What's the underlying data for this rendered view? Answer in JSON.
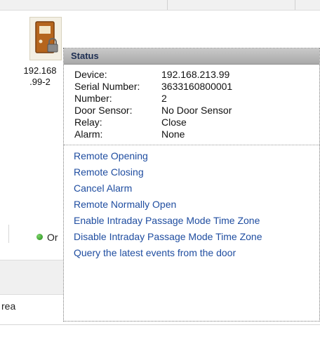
{
  "device": {
    "label_line1": "192.168",
    "label_line2": ".99-2",
    "status_text": "Or"
  },
  "table": {
    "cell_text": "rea"
  },
  "popup": {
    "title": "Status",
    "info": [
      {
        "label": "Device:",
        "value": "192.168.213.99"
      },
      {
        "label": "Serial Number:",
        "value": "3633160800001"
      },
      {
        "label": "Number:",
        "value": "2"
      },
      {
        "label": "Door Sensor:",
        "value": "No Door Sensor"
      },
      {
        "label": "Relay:",
        "value": "Close"
      },
      {
        "label": "Alarm:",
        "value": "None"
      }
    ],
    "actions": [
      "Remote Opening",
      "Remote Closing",
      "Cancel Alarm",
      "Remote Normally Open",
      "Enable Intraday Passage Mode Time Zone",
      "Disable Intraday Passage Mode Time Zone",
      "Query the latest events from the door"
    ]
  },
  "colors": {
    "link": "#1f4da0",
    "online_dot": "#2e9e22",
    "door_icon": "#b5651d"
  },
  "icons": {
    "door": "door-icon",
    "lock": "lock-icon",
    "status_dot": "online-dot-icon"
  }
}
